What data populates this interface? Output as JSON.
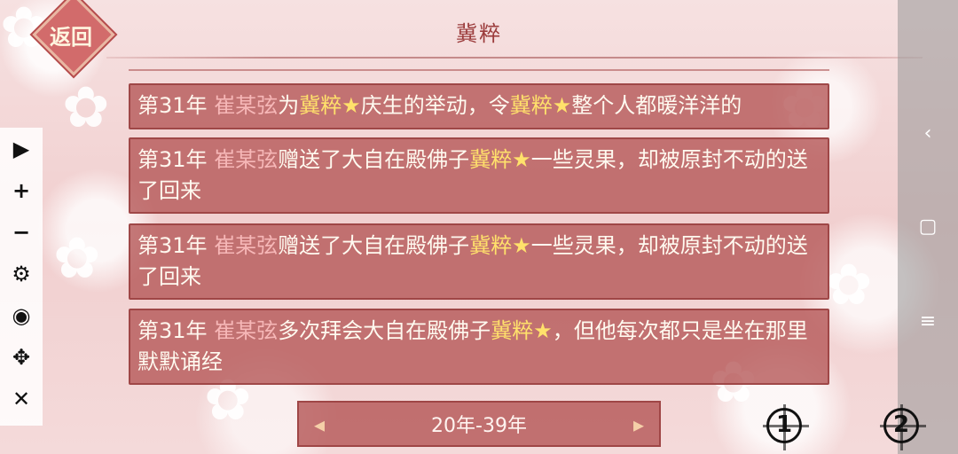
{
  "header": {
    "title": "冀粹",
    "back_label": "返回"
  },
  "toolbar": {
    "items": [
      {
        "name": "play-icon",
        "glyph": "▶"
      },
      {
        "name": "zoom-in-icon",
        "glyph": "+"
      },
      {
        "name": "zoom-out-icon",
        "glyph": "−"
      },
      {
        "name": "settings-icon",
        "glyph": "⚙"
      },
      {
        "name": "hide-icon",
        "glyph": "◉"
      },
      {
        "name": "move-icon",
        "glyph": "✥"
      },
      {
        "name": "close-icon",
        "glyph": "✕"
      }
    ]
  },
  "system_nav": {
    "back_glyph": "‹",
    "home_glyph": "▢",
    "menu_glyph": "≡"
  },
  "messages": [
    {
      "year": "第31年",
      "name": "崔某弦",
      "parts": [
        "为",
        "冀粹★",
        "庆生的举动，令",
        "冀粹★",
        "整个人都暖洋洋的"
      ]
    },
    {
      "year": "第31年",
      "name": "崔某弦",
      "parts": [
        "赠送了大自在殿佛子",
        "冀粹★",
        "一些灵果，却被原封不动的送了回来"
      ]
    },
    {
      "year": "第31年",
      "name": "崔某弦",
      "parts": [
        "赠送了大自在殿佛子",
        "冀粹★",
        "一些灵果，却被原封不动的送了回来"
      ]
    },
    {
      "year": "第31年",
      "name": "崔某弦",
      "parts": [
        "多次拜会大自在殿佛子",
        "冀粹★",
        "，但他每次都只是坐在那里默默诵经"
      ]
    }
  ],
  "pager": {
    "range_label": "20年-39年",
    "prev_glyph": "◂",
    "next_glyph": "▸"
  },
  "circle_buttons": [
    {
      "label": "1"
    },
    {
      "label": "2"
    }
  ],
  "colors": {
    "message_bg": "#b45555",
    "highlight": "#ffe16b",
    "name": "#f6b7b7"
  }
}
